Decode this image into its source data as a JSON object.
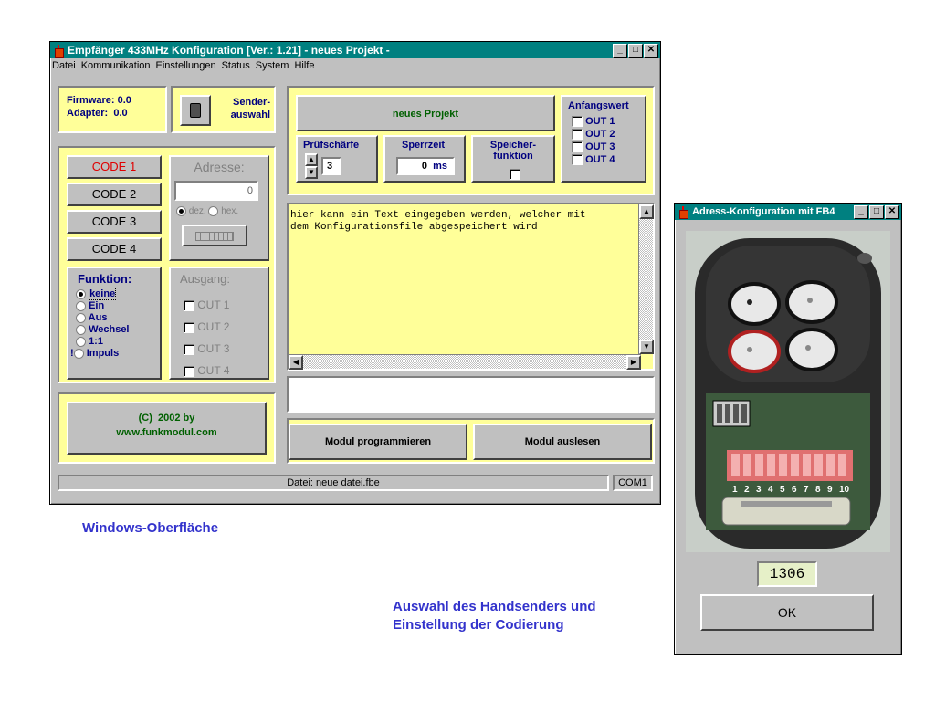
{
  "main_window": {
    "title": "Empfänger 433MHz Konfiguration  [Ver.: 1.21]    - neues Projekt -",
    "menu": [
      "Datei",
      "Kommunikation",
      "Einstellungen",
      "Status",
      "System",
      "Hilfe"
    ],
    "firmware_label": "Firmware: 0.0",
    "adapter_label": "Adapter:  0.0",
    "sender_label_1": "Sender-",
    "sender_label_2": "auswahl",
    "project_name": "neues Projekt",
    "anfangswert": {
      "title": "Anfangswert",
      "outs": [
        "OUT 1",
        "OUT 2",
        "OUT 3",
        "OUT 4"
      ]
    },
    "pruefschaerfe": {
      "label": "Prüfschärfe",
      "value": "3"
    },
    "sperrzeit": {
      "label": "Sperrzeit",
      "value": "0",
      "unit": "ms"
    },
    "speicher": {
      "label1": "Speicher-",
      "label2": "funktion"
    },
    "codes": [
      "CODE 1",
      "CODE 2",
      "CODE 3",
      "CODE 4"
    ],
    "adresse": {
      "label": "Adresse:",
      "value": "0",
      "dez": "dez.",
      "hex": "hex."
    },
    "funktion": {
      "title": "Funktion:",
      "options": [
        "keine",
        "Ein",
        "Aus",
        "Wechsel",
        "1:1",
        "Impuls"
      ],
      "selected": "keine",
      "impuls_prefix": "!"
    },
    "ausgang": {
      "title": "Ausgang:",
      "outs": [
        "OUT 1",
        "OUT 2",
        "OUT 3",
        "OUT 4"
      ]
    },
    "copyright_1": "(C)  2002 by",
    "copyright_2": "www.funkmodul.com",
    "memo_text": "hier kann ein Text eingegeben werden, welcher mit\ndem Konfigurationsfile abgespeichert wird",
    "btn_program": "Modul programmieren",
    "btn_read": "Modul auslesen",
    "status_file": "Datei: neue datei.fbe",
    "status_com": "COM1"
  },
  "remote_window": {
    "title": "Adress-Konfiguration mit FB4",
    "dip_numbers": [
      "1",
      "2",
      "3",
      "4",
      "5",
      "6",
      "7",
      "8",
      "9",
      "10"
    ],
    "code_value": "1306",
    "ok_label": "OK"
  },
  "captions": {
    "left": "Windows-Oberfläche",
    "right_1": "Auswahl des Handsenders und",
    "right_2": "Einstellung der Codierung"
  },
  "colors": {
    "panel_yellow": "#ffff99",
    "title_teal": "#008080",
    "caption_blue": "#3333cc",
    "code_active_red": "#e00000"
  }
}
